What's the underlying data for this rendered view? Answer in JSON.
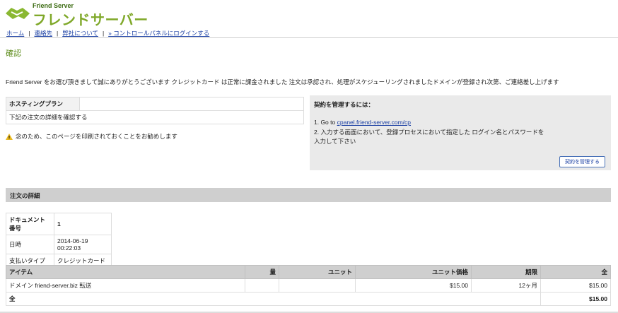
{
  "header": {
    "logo_small": "Friend Server",
    "logo_main": "フレンドサーバー"
  },
  "nav": {
    "items": [
      "ホーム",
      "連絡先",
      "弊社について",
      "» コントロールパネルにログインする"
    ]
  },
  "page": {
    "title": "確認",
    "intro": "Friend Server をお選び頂きまして誠にありがとうございます クレジットカード は正常に課金されました 注文は承認され、処理がスケジューリングされましたドメインが登録され次第、ご連絡差し上げます"
  },
  "plan": {
    "header": "ホスティングプラン",
    "detail_text": "下記の注文の詳細を確認する"
  },
  "warning": {
    "text": "念のため、このページを印刷されておくことをお勧めします"
  },
  "manage": {
    "title": "契約を管理するには：",
    "step1_prefix": "1. Go to ",
    "step1_link": "cpanel.friend-server.com/cp",
    "step2a": "2. 入力する画面において、登録プロセスにおいて指定した ログイン名とパスワードを",
    "step2b": "入力して下さい",
    "button": "契約を管理する"
  },
  "order": {
    "section_title": "注文の詳細",
    "doc": [
      {
        "label": "ドキュメント番号",
        "value": "1"
      },
      {
        "label": "日時",
        "value": "2014-06-19 00:22:03"
      },
      {
        "label": "支払いタイプ",
        "value": "クレジットカード"
      }
    ],
    "columns": [
      "アイテム",
      "量",
      "ユニット",
      "ユニット価格",
      "期限",
      "全"
    ],
    "row": {
      "item": "ドメイン friend-server.biz 転送",
      "qty": "",
      "unit": "",
      "price": "$15.00",
      "term": "12ヶ月",
      "total": "$15.00"
    },
    "total_label": "全",
    "total_value": "$15.00"
  }
}
